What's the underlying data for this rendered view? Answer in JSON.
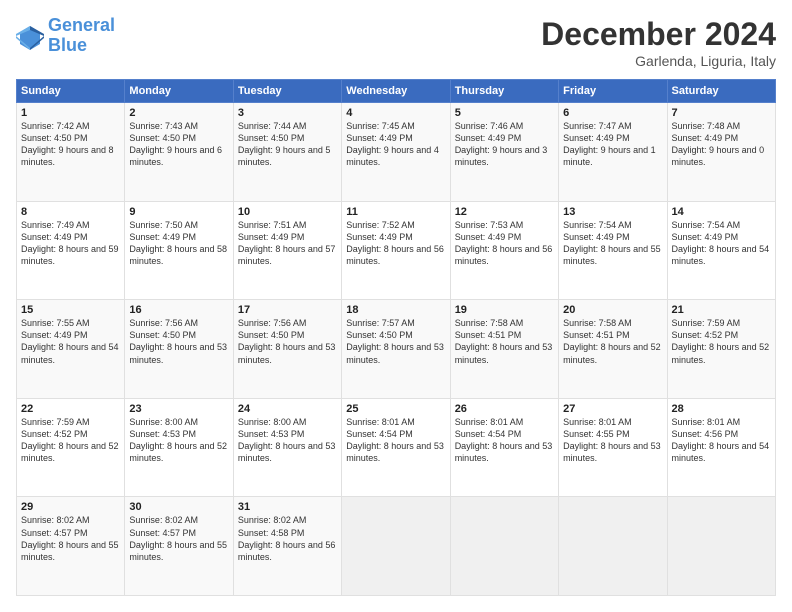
{
  "header": {
    "logo_line1": "General",
    "logo_line2": "Blue",
    "month_title": "December 2024",
    "subtitle": "Garlenda, Liguria, Italy"
  },
  "weekdays": [
    "Sunday",
    "Monday",
    "Tuesday",
    "Wednesday",
    "Thursday",
    "Friday",
    "Saturday"
  ],
  "rows": [
    [
      {
        "day": "1",
        "sunrise": "Sunrise: 7:42 AM",
        "sunset": "Sunset: 4:50 PM",
        "daylight": "Daylight: 9 hours and 8 minutes."
      },
      {
        "day": "2",
        "sunrise": "Sunrise: 7:43 AM",
        "sunset": "Sunset: 4:50 PM",
        "daylight": "Daylight: 9 hours and 6 minutes."
      },
      {
        "day": "3",
        "sunrise": "Sunrise: 7:44 AM",
        "sunset": "Sunset: 4:50 PM",
        "daylight": "Daylight: 9 hours and 5 minutes."
      },
      {
        "day": "4",
        "sunrise": "Sunrise: 7:45 AM",
        "sunset": "Sunset: 4:49 PM",
        "daylight": "Daylight: 9 hours and 4 minutes."
      },
      {
        "day": "5",
        "sunrise": "Sunrise: 7:46 AM",
        "sunset": "Sunset: 4:49 PM",
        "daylight": "Daylight: 9 hours and 3 minutes."
      },
      {
        "day": "6",
        "sunrise": "Sunrise: 7:47 AM",
        "sunset": "Sunset: 4:49 PM",
        "daylight": "Daylight: 9 hours and 1 minute."
      },
      {
        "day": "7",
        "sunrise": "Sunrise: 7:48 AM",
        "sunset": "Sunset: 4:49 PM",
        "daylight": "Daylight: 9 hours and 0 minutes."
      }
    ],
    [
      {
        "day": "8",
        "sunrise": "Sunrise: 7:49 AM",
        "sunset": "Sunset: 4:49 PM",
        "daylight": "Daylight: 8 hours and 59 minutes."
      },
      {
        "day": "9",
        "sunrise": "Sunrise: 7:50 AM",
        "sunset": "Sunset: 4:49 PM",
        "daylight": "Daylight: 8 hours and 58 minutes."
      },
      {
        "day": "10",
        "sunrise": "Sunrise: 7:51 AM",
        "sunset": "Sunset: 4:49 PM",
        "daylight": "Daylight: 8 hours and 57 minutes."
      },
      {
        "day": "11",
        "sunrise": "Sunrise: 7:52 AM",
        "sunset": "Sunset: 4:49 PM",
        "daylight": "Daylight: 8 hours and 56 minutes."
      },
      {
        "day": "12",
        "sunrise": "Sunrise: 7:53 AM",
        "sunset": "Sunset: 4:49 PM",
        "daylight": "Daylight: 8 hours and 56 minutes."
      },
      {
        "day": "13",
        "sunrise": "Sunrise: 7:54 AM",
        "sunset": "Sunset: 4:49 PM",
        "daylight": "Daylight: 8 hours and 55 minutes."
      },
      {
        "day": "14",
        "sunrise": "Sunrise: 7:54 AM",
        "sunset": "Sunset: 4:49 PM",
        "daylight": "Daylight: 8 hours and 54 minutes."
      }
    ],
    [
      {
        "day": "15",
        "sunrise": "Sunrise: 7:55 AM",
        "sunset": "Sunset: 4:49 PM",
        "daylight": "Daylight: 8 hours and 54 minutes."
      },
      {
        "day": "16",
        "sunrise": "Sunrise: 7:56 AM",
        "sunset": "Sunset: 4:50 PM",
        "daylight": "Daylight: 8 hours and 53 minutes."
      },
      {
        "day": "17",
        "sunrise": "Sunrise: 7:56 AM",
        "sunset": "Sunset: 4:50 PM",
        "daylight": "Daylight: 8 hours and 53 minutes."
      },
      {
        "day": "18",
        "sunrise": "Sunrise: 7:57 AM",
        "sunset": "Sunset: 4:50 PM",
        "daylight": "Daylight: 8 hours and 53 minutes."
      },
      {
        "day": "19",
        "sunrise": "Sunrise: 7:58 AM",
        "sunset": "Sunset: 4:51 PM",
        "daylight": "Daylight: 8 hours and 53 minutes."
      },
      {
        "day": "20",
        "sunrise": "Sunrise: 7:58 AM",
        "sunset": "Sunset: 4:51 PM",
        "daylight": "Daylight: 8 hours and 52 minutes."
      },
      {
        "day": "21",
        "sunrise": "Sunrise: 7:59 AM",
        "sunset": "Sunset: 4:52 PM",
        "daylight": "Daylight: 8 hours and 52 minutes."
      }
    ],
    [
      {
        "day": "22",
        "sunrise": "Sunrise: 7:59 AM",
        "sunset": "Sunset: 4:52 PM",
        "daylight": "Daylight: 8 hours and 52 minutes."
      },
      {
        "day": "23",
        "sunrise": "Sunrise: 8:00 AM",
        "sunset": "Sunset: 4:53 PM",
        "daylight": "Daylight: 8 hours and 52 minutes."
      },
      {
        "day": "24",
        "sunrise": "Sunrise: 8:00 AM",
        "sunset": "Sunset: 4:53 PM",
        "daylight": "Daylight: 8 hours and 53 minutes."
      },
      {
        "day": "25",
        "sunrise": "Sunrise: 8:01 AM",
        "sunset": "Sunset: 4:54 PM",
        "daylight": "Daylight: 8 hours and 53 minutes."
      },
      {
        "day": "26",
        "sunrise": "Sunrise: 8:01 AM",
        "sunset": "Sunset: 4:54 PM",
        "daylight": "Daylight: 8 hours and 53 minutes."
      },
      {
        "day": "27",
        "sunrise": "Sunrise: 8:01 AM",
        "sunset": "Sunset: 4:55 PM",
        "daylight": "Daylight: 8 hours and 53 minutes."
      },
      {
        "day": "28",
        "sunrise": "Sunrise: 8:01 AM",
        "sunset": "Sunset: 4:56 PM",
        "daylight": "Daylight: 8 hours and 54 minutes."
      }
    ],
    [
      {
        "day": "29",
        "sunrise": "Sunrise: 8:02 AM",
        "sunset": "Sunset: 4:57 PM",
        "daylight": "Daylight: 8 hours and 55 minutes."
      },
      {
        "day": "30",
        "sunrise": "Sunrise: 8:02 AM",
        "sunset": "Sunset: 4:57 PM",
        "daylight": "Daylight: 8 hours and 55 minutes."
      },
      {
        "day": "31",
        "sunrise": "Sunrise: 8:02 AM",
        "sunset": "Sunset: 4:58 PM",
        "daylight": "Daylight: 8 hours and 56 minutes."
      },
      null,
      null,
      null,
      null
    ]
  ]
}
